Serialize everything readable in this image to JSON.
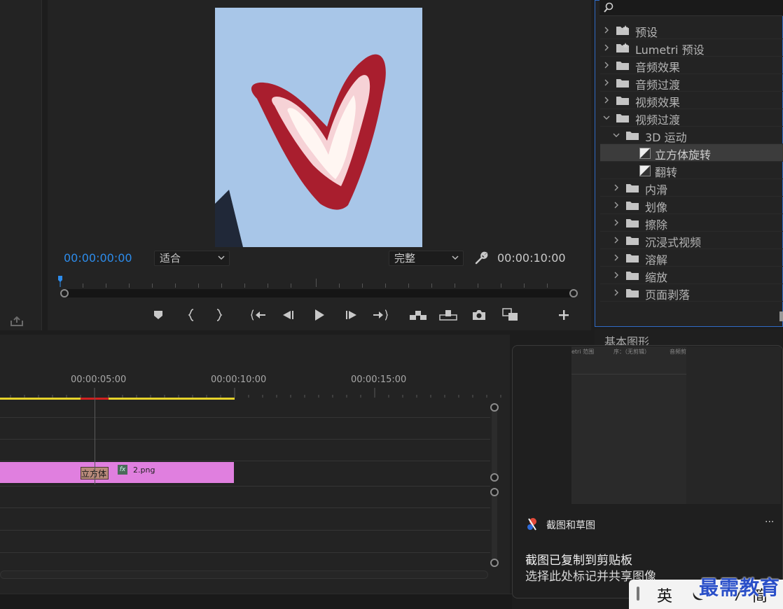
{
  "program_monitor": {
    "current_timecode": "00:00:00:00",
    "zoom_select": "适合",
    "quality_select": "完整",
    "duration_timecode": "00:00:10:00"
  },
  "effects_panel": {
    "search_placeholder": "",
    "items": [
      {
        "label": "预设",
        "type": "preset-folder",
        "expanded": false,
        "level": 0
      },
      {
        "label": "Lumetri 预设",
        "type": "preset-folder",
        "expanded": false,
        "level": 0
      },
      {
        "label": "音频效果",
        "type": "folder",
        "expanded": false,
        "level": 0
      },
      {
        "label": "音频过渡",
        "type": "folder",
        "expanded": false,
        "level": 0
      },
      {
        "label": "视频效果",
        "type": "folder",
        "expanded": false,
        "level": 0
      },
      {
        "label": "视频过渡",
        "type": "folder",
        "expanded": true,
        "level": 0
      },
      {
        "label": "3D 运动",
        "type": "folder",
        "expanded": true,
        "level": 1
      },
      {
        "label": "立方体旋转",
        "type": "effect",
        "selected": true,
        "level": 2
      },
      {
        "label": "翻转",
        "type": "effect",
        "level": 2
      },
      {
        "label": "内滑",
        "type": "folder",
        "expanded": false,
        "level": 1
      },
      {
        "label": "划像",
        "type": "folder",
        "expanded": false,
        "level": 1
      },
      {
        "label": "擦除",
        "type": "folder",
        "expanded": false,
        "level": 1
      },
      {
        "label": "沉浸式视频",
        "type": "folder",
        "expanded": false,
        "level": 1
      },
      {
        "label": "溶解",
        "type": "folder",
        "expanded": false,
        "level": 1
      },
      {
        "label": "缩放",
        "type": "folder",
        "expanded": false,
        "level": 1
      },
      {
        "label": "页面剥落",
        "type": "folder",
        "expanded": false,
        "level": 1
      }
    ]
  },
  "essential_graphics": {
    "title": "基本图形"
  },
  "timeline": {
    "ruler_labels": [
      "00:00:05:00",
      "00:00:10:00",
      "00:00:15:00"
    ],
    "clip": {
      "name": "2.png",
      "fx_badge": "fx",
      "transition_label": "立方体"
    },
    "colors": {
      "clip": "#e07fdf",
      "work_area": "#e6d22a",
      "render_bar": "#d02020"
    }
  },
  "toast": {
    "app_name": "截图和草图",
    "more_label": "···",
    "title": "截图已复制到剪贴板",
    "body": "选择此处标记并共享图像",
    "thumb_texts": [
      "etri 范围",
      "序：（无剪辑）",
      "音频剪辑混合器：2"
    ]
  },
  "ime": {
    "lang": "英",
    "mode": "简"
  },
  "watermark": "最需教育",
  "accent_color": "#2d8ceb"
}
